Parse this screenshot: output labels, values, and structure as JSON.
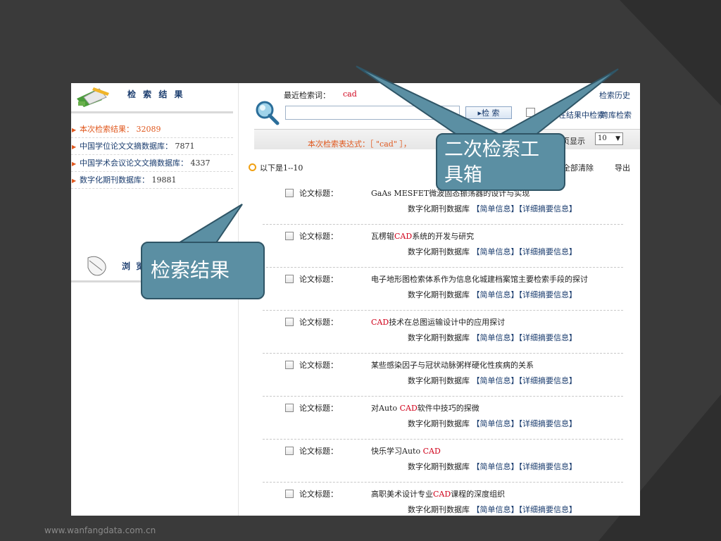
{
  "left_panel": {
    "title": "检 索 结 果",
    "items": [
      {
        "label": "本次检索结果：",
        "count": "32089"
      },
      {
        "label": "中国学位论文文摘数据库：",
        "count": "7871"
      },
      {
        "label": "中国学术会议论文文摘数据库：",
        "count": "4337"
      },
      {
        "label": "数字化期刊数据库：",
        "count": "19881"
      }
    ],
    "browse_label": "浏 览"
  },
  "search": {
    "recent_label": "最近检索词：",
    "recent_term": "cad",
    "history_label": "检索历史",
    "input_value": "",
    "button_label": "▸检  索",
    "within_label": "在结果中检索",
    "cross_db_label": "跨库检索",
    "expression": "本次检索表达式：［ \"cad\" ］，",
    "per_page_label": "每页显示",
    "per_page_value": "10"
  },
  "results_header": {
    "range": "以下是1--10",
    "clear_all": "全部清除",
    "export": "导出"
  },
  "records": [
    {
      "field": "论文标题：",
      "title_parts": [
        "GaAs MESFET微波固态振荡器的设计与实现",
        "",
        ""
      ]
    },
    {
      "field": "论文标题：",
      "title_parts": [
        "瓦楞辊",
        "CAD",
        "系统的开发与研究"
      ]
    },
    {
      "field": "论文标题：",
      "title_parts": [
        "电子地形图检索体系作为信息化城建档案馆主要检索手段的探讨",
        "",
        ""
      ]
    },
    {
      "field": "论文标题：",
      "title_parts": [
        "",
        "CAD",
        "技术在总图运输设计中的应用探讨"
      ]
    },
    {
      "field": "论文标题：",
      "title_parts": [
        "某些感染因子与冠状动脉粥样硬化性疾病的关系",
        "",
        ""
      ]
    },
    {
      "field": "论文标题：",
      "title_parts": [
        "对Auto ",
        "CAD",
        "软件中技巧的探微"
      ]
    },
    {
      "field": "论文标题：",
      "title_parts": [
        "快乐学习Auto ",
        "CAD",
        ""
      ]
    },
    {
      "field": "论文标题：",
      "title_parts": [
        "高职美术设计专业",
        "CAD",
        "课程的深度组织"
      ]
    }
  ],
  "record_source": "数字化期刊数据库",
  "record_links": {
    "simple": "【简单信息】",
    "detail": "【详细摘要信息】"
  },
  "callouts": {
    "tools": "二次检索工具箱",
    "results": "检索结果"
  },
  "watermark": "www.wanfangdata.com.cn",
  "colors": {
    "background": "#3a3a3a",
    "callout_fill": "#5b8fa3",
    "highlight": "#d0021b",
    "link": "#1a3c6e"
  }
}
